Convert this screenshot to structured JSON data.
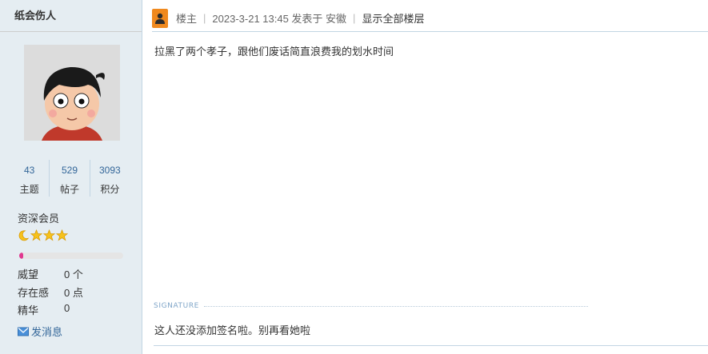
{
  "author": {
    "name": "纸会伤人",
    "stats": [
      {
        "value": "43",
        "label": "主题"
      },
      {
        "value": "529",
        "label": "帖子"
      },
      {
        "value": "3093",
        "label": "积分"
      }
    ],
    "group": "资深会员",
    "star_icons": [
      "moon-icon",
      "star-icon",
      "star-icon",
      "star-icon"
    ],
    "progress_fraction": 0.04,
    "info": [
      {
        "key": "威望",
        "value": "0 个"
      },
      {
        "key": "存在感",
        "value": "0 点"
      },
      {
        "key": "精华",
        "value": "0"
      }
    ],
    "pm_label": "发消息"
  },
  "post": {
    "author_tag": "楼主",
    "meta": "2023-3-21 13:45 发表于 安徽",
    "show_all_floors": "显示全部楼层",
    "body": "拉黑了两个孝子，跟他们废话简直浪费我的划水时间",
    "signature_label": "SIGNATURE",
    "signature_text": "这人还没添加签名啦。别再看她啦"
  },
  "colors": {
    "sidebar_bg": "#e5edf2",
    "badge": "#f0891e",
    "link": "#336699",
    "progress": "#e0388f"
  }
}
